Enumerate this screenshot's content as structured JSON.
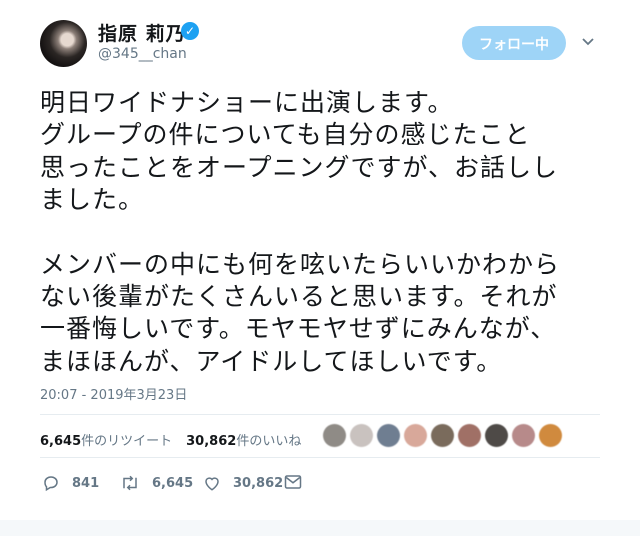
{
  "user": {
    "display_name": "指原 莉乃",
    "handle": "@345__chan",
    "verified_icon": "verified-badge-icon"
  },
  "header": {
    "follow_label": "フォロー中",
    "menu_icon": "chevron-down-icon"
  },
  "tweet": {
    "paragraph1": [
      "明日ワイドナショーに出演します。",
      "グループの件についても自分の感じたこと",
      "思ったことをオープニングですが、お話しし",
      "ました。"
    ],
    "paragraph2": [
      "メンバーの中にも何を呟いたらいいかわから",
      "ない後輩がたくさんいると思います。それが",
      "一番悔しいです。モヤモヤせずにみんなが、",
      "まほほんが、アイドルしてほしいです。"
    ],
    "timestamp": "20:07 - 2019年3月23日"
  },
  "stats": {
    "retweets": "6,645",
    "retweets_label": "件のリツイート",
    "likes": "30,862",
    "likes_label": "件のいいね"
  },
  "actions": {
    "reply_count": "841",
    "retweet_count": "6,645",
    "like_count": "30,862"
  },
  "colors": {
    "text": "#14171a",
    "muted": "#657786",
    "accent": "#1da1f2",
    "follow_bg": "#9ed4f7"
  }
}
